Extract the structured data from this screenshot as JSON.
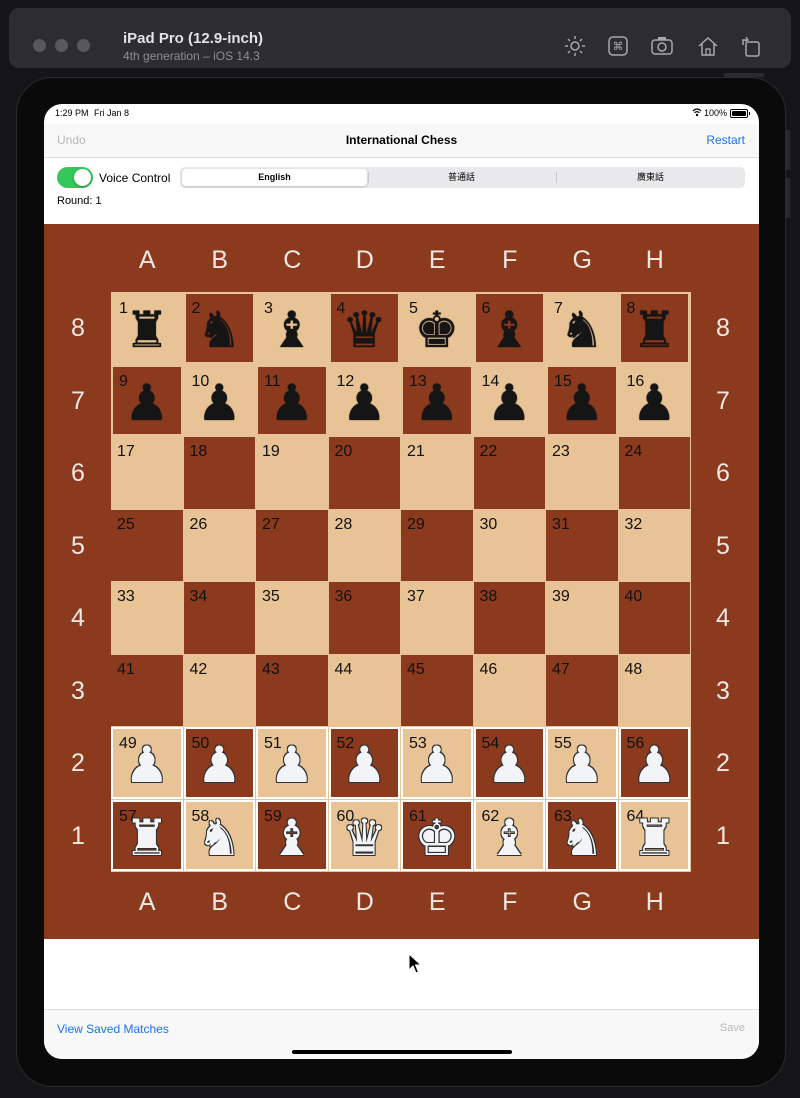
{
  "simulator": {
    "device_name": "iPad Pro (12.9-inch)",
    "device_subtitle": "4th generation – iOS 14.3",
    "toolbar_icons": [
      "brightness-icon",
      "command-icon",
      "screenshot-icon",
      "home-icon",
      "rotate-icon"
    ]
  },
  "status_bar": {
    "time": "1:29 PM",
    "date": "Fri Jan 8",
    "battery": "100%"
  },
  "nav": {
    "undo": "Undo",
    "title": "International Chess",
    "restart": "Restart"
  },
  "controls": {
    "voice_control_label": "Voice Control",
    "voice_control_on": true,
    "languages": [
      "English",
      "普通話",
      "廣東話"
    ],
    "selected_language": "English",
    "round_label": "Round:",
    "round_value": "1"
  },
  "board": {
    "files": [
      "A",
      "B",
      "C",
      "D",
      "E",
      "F",
      "G",
      "H"
    ],
    "ranks": [
      "8",
      "7",
      "6",
      "5",
      "4",
      "3",
      "2",
      "1"
    ],
    "square_numbers": [
      "1",
      "2",
      "3",
      "4",
      "5",
      "6",
      "7",
      "8",
      "9",
      "10",
      "11",
      "12",
      "13",
      "14",
      "15",
      "16",
      "17",
      "18",
      "19",
      "20",
      "21",
      "22",
      "23",
      "24",
      "25",
      "26",
      "27",
      "28",
      "29",
      "30",
      "31",
      "32",
      "33",
      "34",
      "35",
      "36",
      "37",
      "38",
      "39",
      "40",
      "41",
      "42",
      "43",
      "44",
      "45",
      "46",
      "47",
      "48",
      "49",
      "50",
      "51",
      "52",
      "53",
      "54",
      "55",
      "56",
      "57",
      "58",
      "59",
      "60",
      "61",
      "62",
      "63",
      "64"
    ],
    "pieces": {
      "1": "black-rook",
      "2": "black-knight",
      "3": "black-bishop",
      "4": "black-queen",
      "5": "black-king",
      "6": "black-bishop",
      "7": "black-knight",
      "8": "black-rook",
      "9": "black-pawn",
      "10": "black-pawn",
      "11": "black-pawn",
      "12": "black-pawn",
      "13": "black-pawn",
      "14": "black-pawn",
      "15": "black-pawn",
      "16": "black-pawn",
      "49": "white-pawn",
      "50": "white-pawn",
      "51": "white-pawn",
      "52": "white-pawn",
      "53": "white-pawn",
      "54": "white-pawn",
      "55": "white-pawn",
      "56": "white-pawn",
      "57": "white-rook",
      "58": "white-knight",
      "59": "white-bishop",
      "60": "white-queen",
      "61": "white-king",
      "62": "white-bishop",
      "63": "white-knight",
      "64": "white-rook"
    },
    "colors": {
      "border": "#8b3a1e",
      "light": "#e8c395",
      "dark": "#8b3a1e"
    }
  },
  "bottom": {
    "view_saved": "View Saved Matches",
    "save": "Save"
  },
  "colors": {
    "accent": "#1a73e8",
    "toggle_on": "#34c759",
    "disabled": "#b7b7b9"
  }
}
